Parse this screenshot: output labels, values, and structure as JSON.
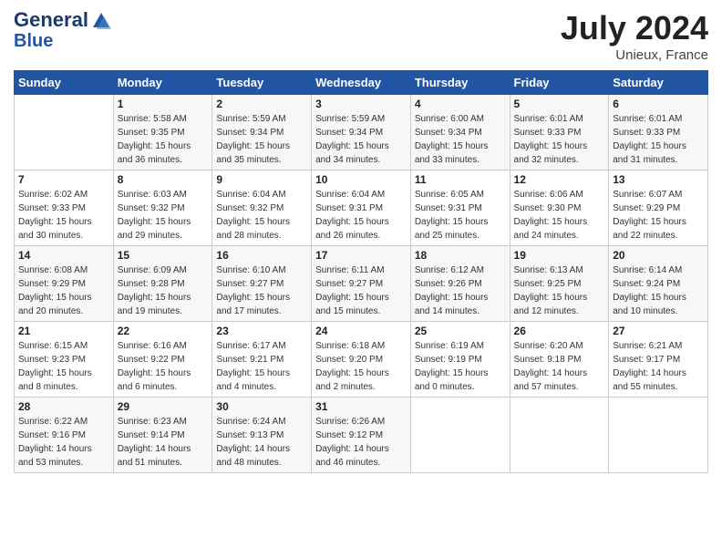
{
  "header": {
    "logo_line1": "General",
    "logo_line2": "Blue",
    "month_year": "July 2024",
    "location": "Unieux, France"
  },
  "days_of_week": [
    "Sunday",
    "Monday",
    "Tuesday",
    "Wednesday",
    "Thursday",
    "Friday",
    "Saturday"
  ],
  "weeks": [
    [
      {
        "day": "",
        "detail": ""
      },
      {
        "day": "1",
        "detail": "Sunrise: 5:58 AM\nSunset: 9:35 PM\nDaylight: 15 hours\nand 36 minutes."
      },
      {
        "day": "2",
        "detail": "Sunrise: 5:59 AM\nSunset: 9:34 PM\nDaylight: 15 hours\nand 35 minutes."
      },
      {
        "day": "3",
        "detail": "Sunrise: 5:59 AM\nSunset: 9:34 PM\nDaylight: 15 hours\nand 34 minutes."
      },
      {
        "day": "4",
        "detail": "Sunrise: 6:00 AM\nSunset: 9:34 PM\nDaylight: 15 hours\nand 33 minutes."
      },
      {
        "day": "5",
        "detail": "Sunrise: 6:01 AM\nSunset: 9:33 PM\nDaylight: 15 hours\nand 32 minutes."
      },
      {
        "day": "6",
        "detail": "Sunrise: 6:01 AM\nSunset: 9:33 PM\nDaylight: 15 hours\nand 31 minutes."
      }
    ],
    [
      {
        "day": "7",
        "detail": "Sunrise: 6:02 AM\nSunset: 9:33 PM\nDaylight: 15 hours\nand 30 minutes."
      },
      {
        "day": "8",
        "detail": "Sunrise: 6:03 AM\nSunset: 9:32 PM\nDaylight: 15 hours\nand 29 minutes."
      },
      {
        "day": "9",
        "detail": "Sunrise: 6:04 AM\nSunset: 9:32 PM\nDaylight: 15 hours\nand 28 minutes."
      },
      {
        "day": "10",
        "detail": "Sunrise: 6:04 AM\nSunset: 9:31 PM\nDaylight: 15 hours\nand 26 minutes."
      },
      {
        "day": "11",
        "detail": "Sunrise: 6:05 AM\nSunset: 9:31 PM\nDaylight: 15 hours\nand 25 minutes."
      },
      {
        "day": "12",
        "detail": "Sunrise: 6:06 AM\nSunset: 9:30 PM\nDaylight: 15 hours\nand 24 minutes."
      },
      {
        "day": "13",
        "detail": "Sunrise: 6:07 AM\nSunset: 9:29 PM\nDaylight: 15 hours\nand 22 minutes."
      }
    ],
    [
      {
        "day": "14",
        "detail": "Sunrise: 6:08 AM\nSunset: 9:29 PM\nDaylight: 15 hours\nand 20 minutes."
      },
      {
        "day": "15",
        "detail": "Sunrise: 6:09 AM\nSunset: 9:28 PM\nDaylight: 15 hours\nand 19 minutes."
      },
      {
        "day": "16",
        "detail": "Sunrise: 6:10 AM\nSunset: 9:27 PM\nDaylight: 15 hours\nand 17 minutes."
      },
      {
        "day": "17",
        "detail": "Sunrise: 6:11 AM\nSunset: 9:27 PM\nDaylight: 15 hours\nand 15 minutes."
      },
      {
        "day": "18",
        "detail": "Sunrise: 6:12 AM\nSunset: 9:26 PM\nDaylight: 15 hours\nand 14 minutes."
      },
      {
        "day": "19",
        "detail": "Sunrise: 6:13 AM\nSunset: 9:25 PM\nDaylight: 15 hours\nand 12 minutes."
      },
      {
        "day": "20",
        "detail": "Sunrise: 6:14 AM\nSunset: 9:24 PM\nDaylight: 15 hours\nand 10 minutes."
      }
    ],
    [
      {
        "day": "21",
        "detail": "Sunrise: 6:15 AM\nSunset: 9:23 PM\nDaylight: 15 hours\nand 8 minutes."
      },
      {
        "day": "22",
        "detail": "Sunrise: 6:16 AM\nSunset: 9:22 PM\nDaylight: 15 hours\nand 6 minutes."
      },
      {
        "day": "23",
        "detail": "Sunrise: 6:17 AM\nSunset: 9:21 PM\nDaylight: 15 hours\nand 4 minutes."
      },
      {
        "day": "24",
        "detail": "Sunrise: 6:18 AM\nSunset: 9:20 PM\nDaylight: 15 hours\nand 2 minutes."
      },
      {
        "day": "25",
        "detail": "Sunrise: 6:19 AM\nSunset: 9:19 PM\nDaylight: 15 hours\nand 0 minutes."
      },
      {
        "day": "26",
        "detail": "Sunrise: 6:20 AM\nSunset: 9:18 PM\nDaylight: 14 hours\nand 57 minutes."
      },
      {
        "day": "27",
        "detail": "Sunrise: 6:21 AM\nSunset: 9:17 PM\nDaylight: 14 hours\nand 55 minutes."
      }
    ],
    [
      {
        "day": "28",
        "detail": "Sunrise: 6:22 AM\nSunset: 9:16 PM\nDaylight: 14 hours\nand 53 minutes."
      },
      {
        "day": "29",
        "detail": "Sunrise: 6:23 AM\nSunset: 9:14 PM\nDaylight: 14 hours\nand 51 minutes."
      },
      {
        "day": "30",
        "detail": "Sunrise: 6:24 AM\nSunset: 9:13 PM\nDaylight: 14 hours\nand 48 minutes."
      },
      {
        "day": "31",
        "detail": "Sunrise: 6:26 AM\nSunset: 9:12 PM\nDaylight: 14 hours\nand 46 minutes."
      },
      {
        "day": "",
        "detail": ""
      },
      {
        "day": "",
        "detail": ""
      },
      {
        "day": "",
        "detail": ""
      }
    ]
  ]
}
